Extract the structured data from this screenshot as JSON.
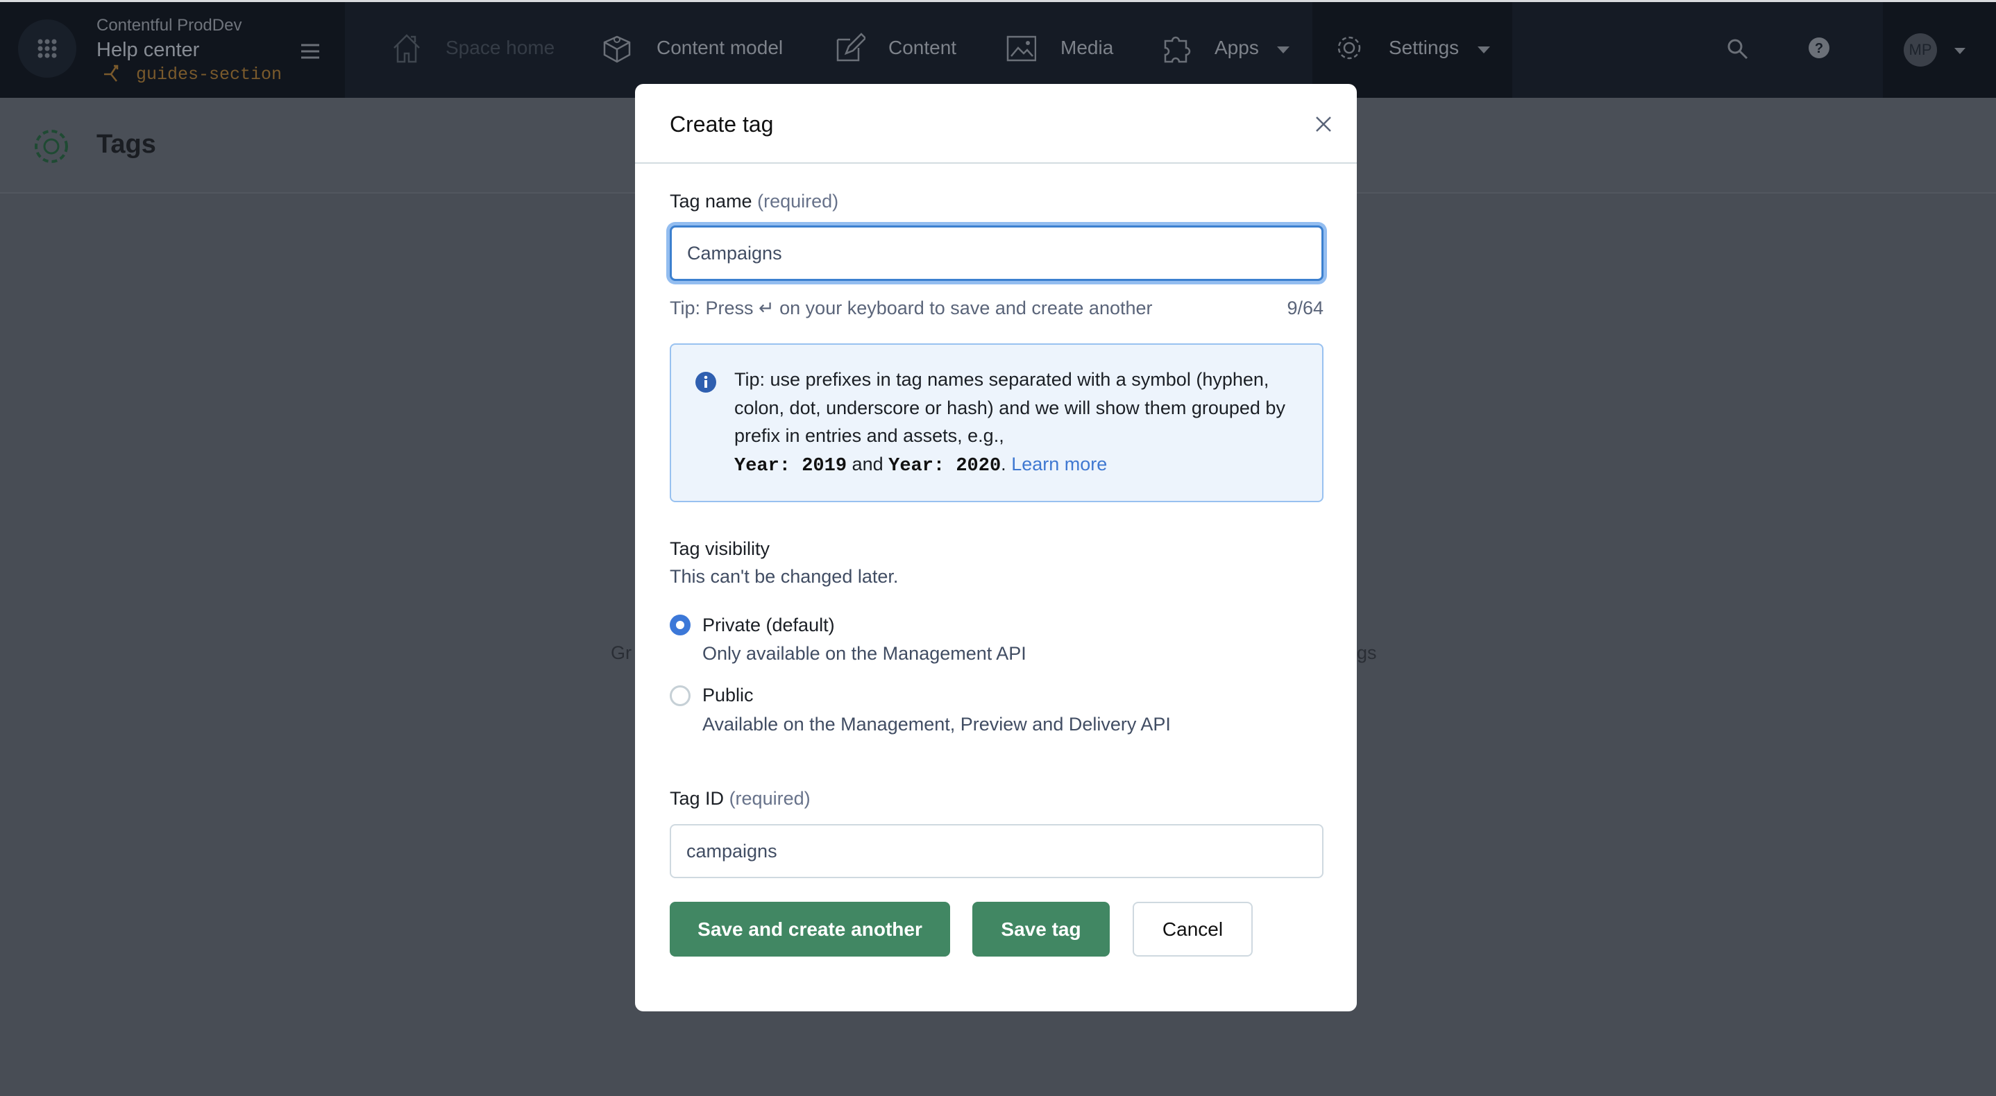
{
  "header": {
    "org_name": "Contentful ProdDev",
    "space_name": "Help center",
    "environment": "guides-section",
    "nav": [
      {
        "label": "Space home",
        "icon": "home-icon"
      },
      {
        "label": "Content model",
        "icon": "content-model-icon"
      },
      {
        "label": "Content",
        "icon": "edit-icon"
      },
      {
        "label": "Media",
        "icon": "image-icon"
      },
      {
        "label": "Apps",
        "icon": "puzzle-icon"
      },
      {
        "label": "Settings",
        "icon": "gear-icon"
      }
    ],
    "avatar_initials": "MP"
  },
  "page": {
    "title": "Tags",
    "background_fragments": [
      "Gr",
      "gs"
    ]
  },
  "modal": {
    "title": "Create tag",
    "tag_name_label": "Tag name",
    "required": "(required)",
    "tag_name_value": "Campaigns",
    "tip_press": "Tip: Press ↵ on your keyboard to save and create another",
    "char_count": "9/64",
    "info_text": "Tip: use prefixes in tag names separated with a symbol (hyphen, colon, dot, underscore or hash) and we will show them grouped by prefix in entries and assets, e.g.,",
    "example1": "Year: 2019",
    "and": "and",
    "example2": "Year: 2020",
    "period": ".",
    "learn_more": "Learn more",
    "visibility_label": "Tag visibility",
    "visibility_hint": "This can't be changed later.",
    "options": [
      {
        "label": "Private (default)",
        "desc": "Only available on the Management API",
        "selected": true
      },
      {
        "label": "Public",
        "desc": "Available on the Management, Preview and Delivery API",
        "selected": false
      }
    ],
    "tag_id_label": "Tag ID",
    "tag_id_value": "campaigns",
    "buttons": {
      "save_another": "Save and create another",
      "save": "Save tag",
      "cancel": "Cancel"
    }
  },
  "colors": {
    "primary": "#418763",
    "focus": "#3c80cf",
    "link": "#3f78d1",
    "info_bg": "#edf4fc"
  }
}
